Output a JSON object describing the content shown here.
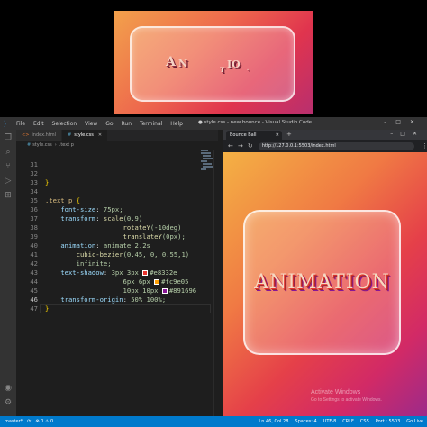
{
  "preview": {
    "letters": [
      "A",
      "N",
      "T",
      "IO",
      "."
    ]
  },
  "titlebar": {
    "menu": [
      "File",
      "Edit",
      "Selection",
      "View",
      "Go",
      "Run",
      "Terminal",
      "Help"
    ],
    "title": "● style.css - new bounce - Visual Studio Code"
  },
  "tabs": [
    {
      "label": "index.html",
      "active": false
    },
    {
      "label": "style.css",
      "active": true
    }
  ],
  "breadcrumb": [
    "style.css",
    ".text p"
  ],
  "code": {
    "current_line": "46",
    "lines": [
      {
        "n": "31"
      },
      {
        "n": "32"
      },
      {
        "n": "33",
        "brace": "}"
      },
      {
        "n": "34"
      },
      {
        "n": "35",
        "sel": ".text p",
        "brace": "{"
      },
      {
        "n": "36",
        "prop": "font-size",
        "val": "75px;"
      },
      {
        "n": "37",
        "prop": "transform",
        "fn": "scale",
        "val": "(0.9)"
      },
      {
        "n": "38",
        "fn": "rotateY",
        "val": "(-10deg)"
      },
      {
        "n": "39",
        "fn": "translateY",
        "val": "(0px);"
      },
      {
        "n": "40",
        "prop": "animation",
        "val": "animate 2.2s"
      },
      {
        "n": "41",
        "fn": "cubic-bezier",
        "val": "(0.45, 0, 0.55,1)"
      },
      {
        "n": "42",
        "val": "infinite;"
      },
      {
        "n": "43",
        "prop": "text-shadow",
        "val": "3px 3px",
        "color": "#e8332e"
      },
      {
        "n": "44",
        "val": "6px 6px",
        "color": "#fc9e05"
      },
      {
        "n": "45",
        "val": "10px 10px",
        "color": "#891696"
      },
      {
        "n": "46",
        "prop": "transform-origin",
        "val": "50% 100%;"
      },
      {
        "n": "47",
        "brace": "}"
      }
    ]
  },
  "browser": {
    "tab_title": "Bounce Ball",
    "url": "http://127.0.0.1:5503/index.html",
    "page_text": "ANIMATION"
  },
  "watermark": {
    "line1": "Activate Windows",
    "line2": "Go to Settings to activate Windows."
  },
  "statusbar": {
    "branch": "master*",
    "sync": "⟳",
    "errors": "⊗ 0 ⚠ 0",
    "position": "Ln 46, Col 28",
    "spaces": "Spaces: 4",
    "encoding": "UTF-8",
    "eol": "CRLF",
    "language": "CSS",
    "port": "Port : 5503",
    "live": "Go Live"
  },
  "colors": {
    "accent": "#007acc",
    "shadow1": "#e8332e",
    "shadow2": "#fc9e05",
    "shadow3": "#891696"
  }
}
